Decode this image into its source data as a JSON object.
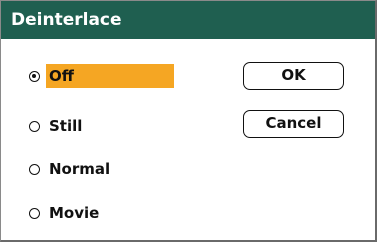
{
  "dialog": {
    "title": "Deinterlace",
    "options": [
      {
        "label": "Off",
        "selected": true
      },
      {
        "label": "Still",
        "selected": false
      },
      {
        "label": "Normal",
        "selected": false
      },
      {
        "label": "Movie",
        "selected": false
      }
    ],
    "ok_label": "OK",
    "cancel_label": "Cancel"
  },
  "colors": {
    "titlebar": "#1f5f50",
    "highlight": "#f5a623"
  }
}
